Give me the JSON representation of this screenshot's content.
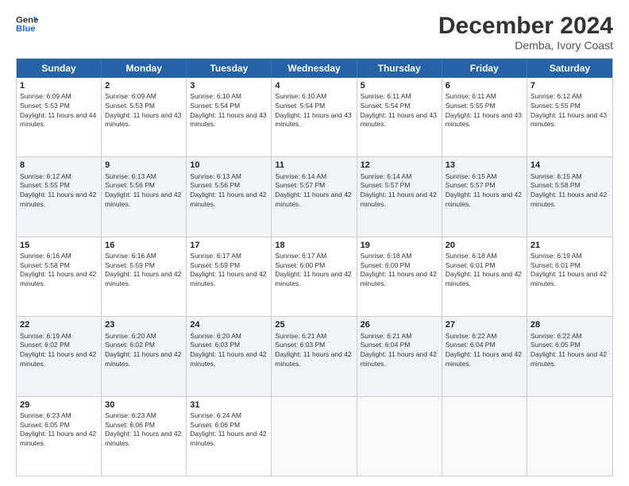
{
  "logo": {
    "line1": "General",
    "line2": "Blue"
  },
  "title": "December 2024",
  "subtitle": "Demba, Ivory Coast",
  "header_days": [
    "Sunday",
    "Monday",
    "Tuesday",
    "Wednesday",
    "Thursday",
    "Friday",
    "Saturday"
  ],
  "weeks": [
    {
      "alt": false,
      "days": [
        {
          "num": "1",
          "sunrise": "Sunrise: 6:09 AM",
          "sunset": "Sunset: 5:53 PM",
          "daylight": "Daylight: 11 hours and 44 minutes."
        },
        {
          "num": "2",
          "sunrise": "Sunrise: 6:09 AM",
          "sunset": "Sunset: 5:53 PM",
          "daylight": "Daylight: 11 hours and 43 minutes."
        },
        {
          "num": "3",
          "sunrise": "Sunrise: 6:10 AM",
          "sunset": "Sunset: 5:54 PM",
          "daylight": "Daylight: 11 hours and 43 minutes."
        },
        {
          "num": "4",
          "sunrise": "Sunrise: 6:10 AM",
          "sunset": "Sunset: 5:54 PM",
          "daylight": "Daylight: 11 hours and 43 minutes."
        },
        {
          "num": "5",
          "sunrise": "Sunrise: 6:11 AM",
          "sunset": "Sunset: 5:54 PM",
          "daylight": "Daylight: 11 hours and 43 minutes."
        },
        {
          "num": "6",
          "sunrise": "Sunrise: 6:11 AM",
          "sunset": "Sunset: 5:55 PM",
          "daylight": "Daylight: 11 hours and 43 minutes."
        },
        {
          "num": "7",
          "sunrise": "Sunrise: 6:12 AM",
          "sunset": "Sunset: 5:55 PM",
          "daylight": "Daylight: 11 hours and 43 minutes."
        }
      ]
    },
    {
      "alt": true,
      "days": [
        {
          "num": "8",
          "sunrise": "Sunrise: 6:12 AM",
          "sunset": "Sunset: 5:55 PM",
          "daylight": "Daylight: 11 hours and 42 minutes."
        },
        {
          "num": "9",
          "sunrise": "Sunrise: 6:13 AM",
          "sunset": "Sunset: 5:56 PM",
          "daylight": "Daylight: 11 hours and 42 minutes."
        },
        {
          "num": "10",
          "sunrise": "Sunrise: 6:13 AM",
          "sunset": "Sunset: 5:56 PM",
          "daylight": "Daylight: 11 hours and 42 minutes."
        },
        {
          "num": "11",
          "sunrise": "Sunrise: 6:14 AM",
          "sunset": "Sunset: 5:57 PM",
          "daylight": "Daylight: 11 hours and 42 minutes."
        },
        {
          "num": "12",
          "sunrise": "Sunrise: 6:14 AM",
          "sunset": "Sunset: 5:57 PM",
          "daylight": "Daylight: 11 hours and 42 minutes."
        },
        {
          "num": "13",
          "sunrise": "Sunrise: 6:15 AM",
          "sunset": "Sunset: 5:57 PM",
          "daylight": "Daylight: 11 hours and 42 minutes."
        },
        {
          "num": "14",
          "sunrise": "Sunrise: 6:15 AM",
          "sunset": "Sunset: 5:58 PM",
          "daylight": "Daylight: 11 hours and 42 minutes."
        }
      ]
    },
    {
      "alt": false,
      "days": [
        {
          "num": "15",
          "sunrise": "Sunrise: 6:16 AM",
          "sunset": "Sunset: 5:58 PM",
          "daylight": "Daylight: 11 hours and 42 minutes."
        },
        {
          "num": "16",
          "sunrise": "Sunrise: 6:16 AM",
          "sunset": "Sunset: 5:59 PM",
          "daylight": "Daylight: 11 hours and 42 minutes."
        },
        {
          "num": "17",
          "sunrise": "Sunrise: 6:17 AM",
          "sunset": "Sunset: 5:59 PM",
          "daylight": "Daylight: 11 hours and 42 minutes."
        },
        {
          "num": "18",
          "sunrise": "Sunrise: 6:17 AM",
          "sunset": "Sunset: 6:00 PM",
          "daylight": "Daylight: 11 hours and 42 minutes."
        },
        {
          "num": "19",
          "sunrise": "Sunrise: 6:18 AM",
          "sunset": "Sunset: 6:00 PM",
          "daylight": "Daylight: 11 hours and 42 minutes."
        },
        {
          "num": "20",
          "sunrise": "Sunrise: 6:18 AM",
          "sunset": "Sunset: 6:01 PM",
          "daylight": "Daylight: 11 hours and 42 minutes."
        },
        {
          "num": "21",
          "sunrise": "Sunrise: 6:19 AM",
          "sunset": "Sunset: 6:01 PM",
          "daylight": "Daylight: 11 hours and 42 minutes."
        }
      ]
    },
    {
      "alt": true,
      "days": [
        {
          "num": "22",
          "sunrise": "Sunrise: 6:19 AM",
          "sunset": "Sunset: 6:02 PM",
          "daylight": "Daylight: 11 hours and 42 minutes."
        },
        {
          "num": "23",
          "sunrise": "Sunrise: 6:20 AM",
          "sunset": "Sunset: 6:02 PM",
          "daylight": "Daylight: 11 hours and 42 minutes."
        },
        {
          "num": "24",
          "sunrise": "Sunrise: 6:20 AM",
          "sunset": "Sunset: 6:03 PM",
          "daylight": "Daylight: 11 hours and 42 minutes."
        },
        {
          "num": "25",
          "sunrise": "Sunrise: 6:21 AM",
          "sunset": "Sunset: 6:03 PM",
          "daylight": "Daylight: 11 hours and 42 minutes."
        },
        {
          "num": "26",
          "sunrise": "Sunrise: 6:21 AM",
          "sunset": "Sunset: 6:04 PM",
          "daylight": "Daylight: 11 hours and 42 minutes."
        },
        {
          "num": "27",
          "sunrise": "Sunrise: 6:22 AM",
          "sunset": "Sunset: 6:04 PM",
          "daylight": "Daylight: 11 hours and 42 minutes."
        },
        {
          "num": "28",
          "sunrise": "Sunrise: 6:22 AM",
          "sunset": "Sunset: 6:05 PM",
          "daylight": "Daylight: 11 hours and 42 minutes."
        }
      ]
    },
    {
      "alt": false,
      "days": [
        {
          "num": "29",
          "sunrise": "Sunrise: 6:23 AM",
          "sunset": "Sunset: 6:05 PM",
          "daylight": "Daylight: 11 hours and 42 minutes."
        },
        {
          "num": "30",
          "sunrise": "Sunrise: 6:23 AM",
          "sunset": "Sunset: 6:06 PM",
          "daylight": "Daylight: 11 hours and 42 minutes."
        },
        {
          "num": "31",
          "sunrise": "Sunrise: 6:24 AM",
          "sunset": "Sunset: 6:06 PM",
          "daylight": "Daylight: 11 hours and 42 minutes."
        },
        {
          "num": "",
          "sunrise": "",
          "sunset": "",
          "daylight": ""
        },
        {
          "num": "",
          "sunrise": "",
          "sunset": "",
          "daylight": ""
        },
        {
          "num": "",
          "sunrise": "",
          "sunset": "",
          "daylight": ""
        },
        {
          "num": "",
          "sunrise": "",
          "sunset": "",
          "daylight": ""
        }
      ]
    }
  ]
}
